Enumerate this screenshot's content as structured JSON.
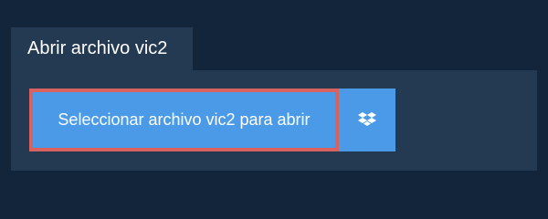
{
  "tab": {
    "label": "Abrir archivo vic2"
  },
  "actions": {
    "select_file_label": "Seleccionar archivo vic2 para abrir",
    "dropbox_icon": "dropbox-icon"
  },
  "colors": {
    "background": "#13253b",
    "panel": "#243a52",
    "button": "#4a9ae8",
    "focus_outline": "#d9625f",
    "text": "#ffffff"
  }
}
